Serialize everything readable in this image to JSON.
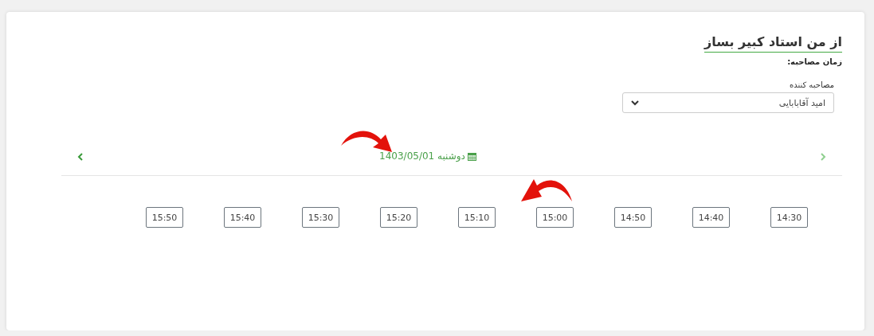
{
  "title": "از من استاد کبیر بساز",
  "subtitle": "زمان مصاحبه:",
  "interviewer": {
    "label": "مصاحبه کننده",
    "value": "امید آقابابایی"
  },
  "date_nav": {
    "day": "دوشنبه",
    "date": "1403/05/01",
    "prev_disabled": true,
    "next_disabled": false
  },
  "time_slots": [
    {
      "label": "14:30",
      "selected": false
    },
    {
      "label": "14:40",
      "selected": false
    },
    {
      "label": "14:50",
      "selected": false
    },
    {
      "label": "15:00",
      "selected": false
    },
    {
      "label": "15:10",
      "selected": false
    },
    {
      "label": "15:20",
      "selected": false
    },
    {
      "label": "15:30",
      "selected": false
    },
    {
      "label": "15:40",
      "selected": false
    },
    {
      "label": "15:50",
      "selected": false
    }
  ]
}
